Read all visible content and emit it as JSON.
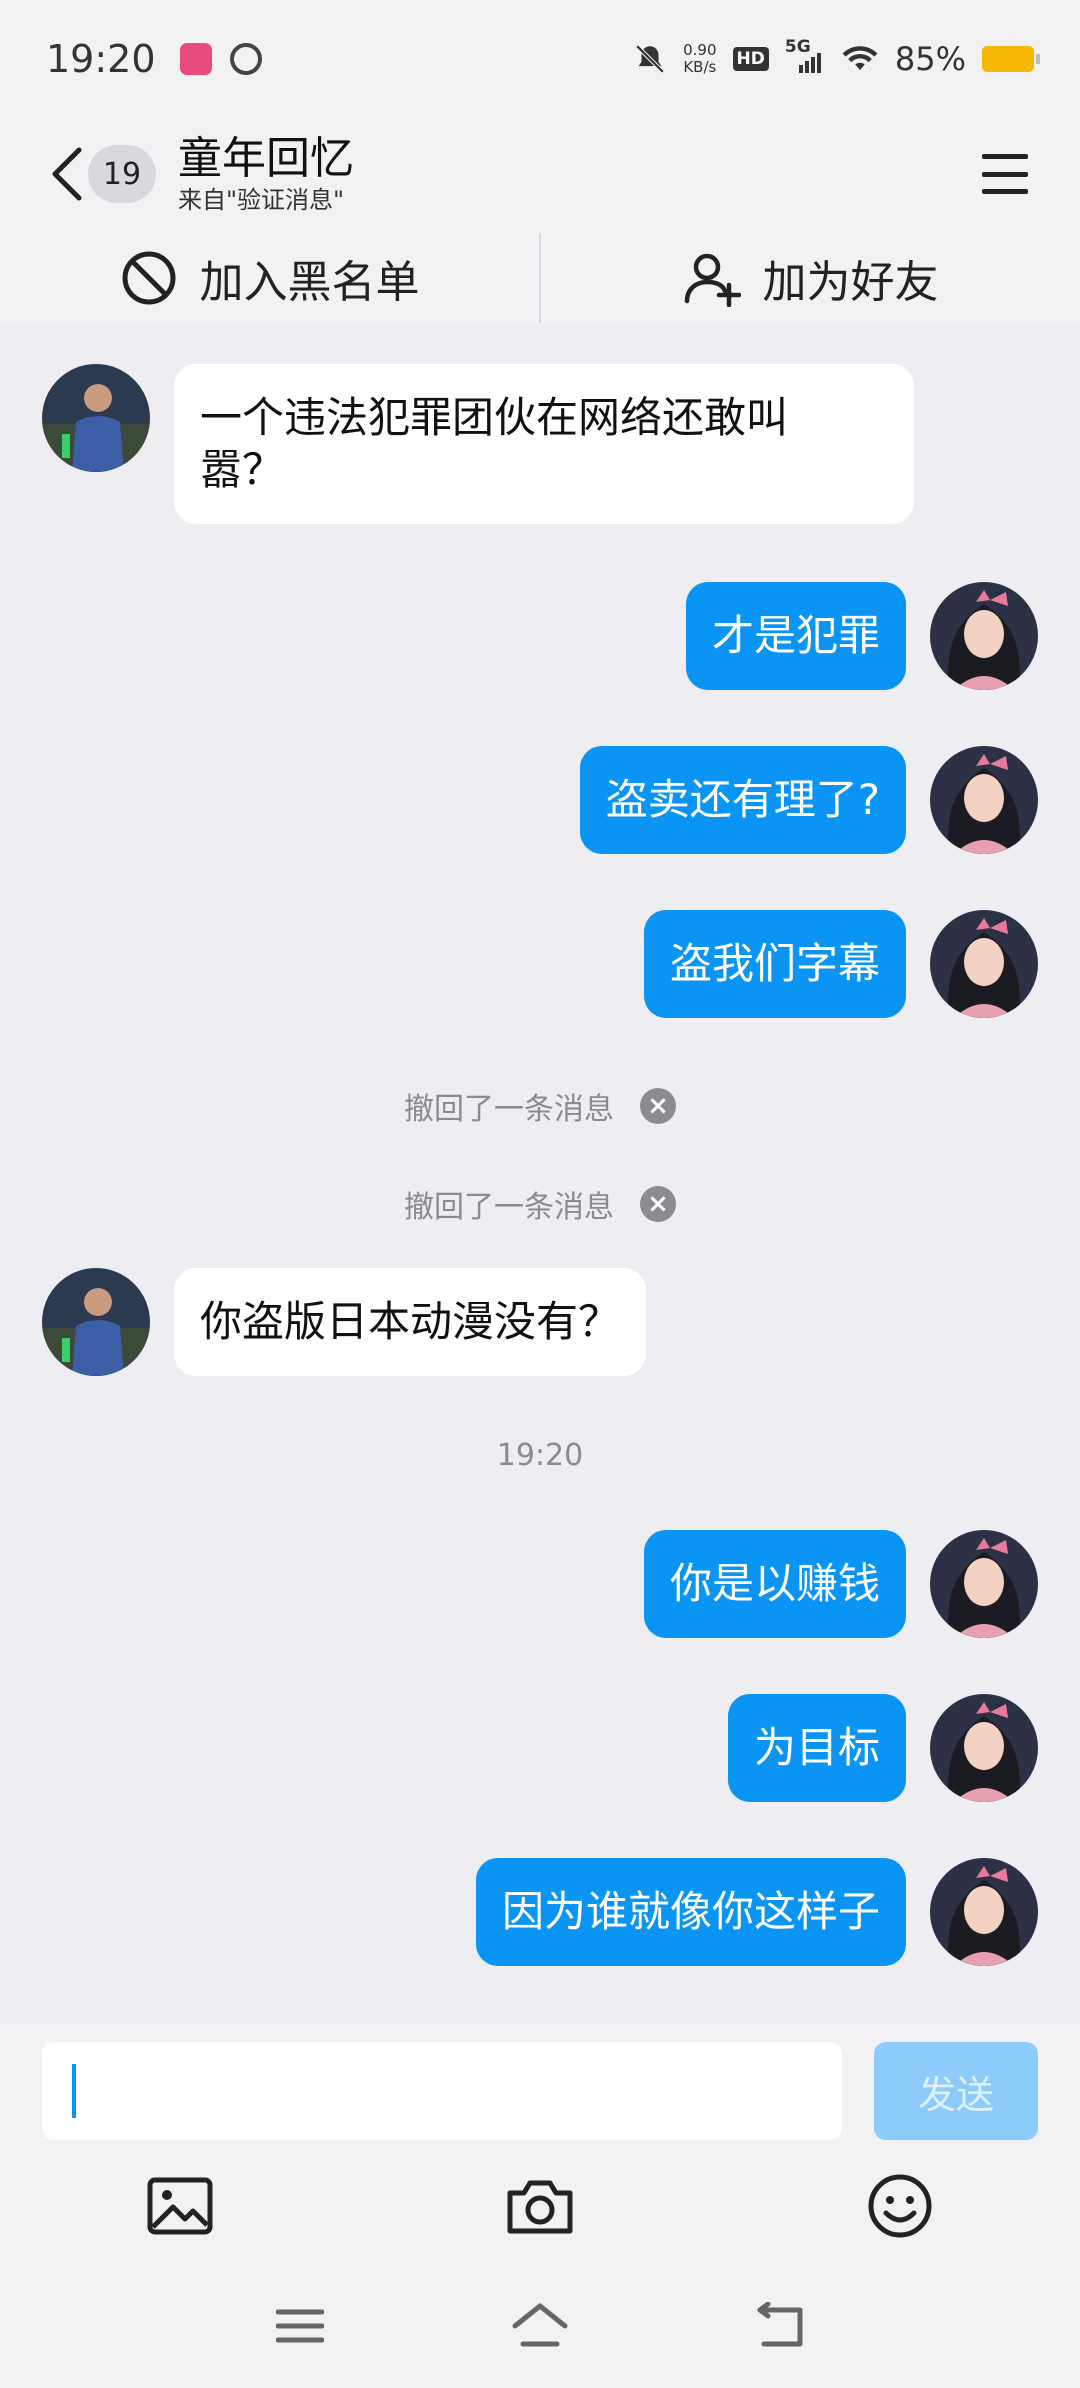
{
  "status_bar": {
    "time": "19:20",
    "net_speed_value": "0.90",
    "net_speed_unit": "KB/s",
    "hd": "HD",
    "network": "5G",
    "battery": "85%",
    "icons": [
      "mute-icon",
      "signal-icon",
      "wifi-icon",
      "battery-icon"
    ]
  },
  "header": {
    "back_count": "19",
    "title": "童年回忆",
    "subtitle": "来自\"验证消息\""
  },
  "actions": {
    "blacklist_label": "加入黑名单",
    "add_friend_label": "加为好友"
  },
  "messages": [
    {
      "side": "in",
      "text": "一个违法犯罪团伙在网络还敢叫\n嚣？"
    },
    {
      "side": "out",
      "text": "才是犯罪"
    },
    {
      "side": "out",
      "text": "盗卖还有理了?"
    },
    {
      "side": "out",
      "text": "盗我们字幕"
    },
    {
      "side": "out",
      "text": "你盗版日本动漫没有？"
    },
    {
      "side": "out",
      "text": "你是以赚钱"
    },
    {
      "side": "out",
      "text": "为目标"
    },
    {
      "side": "out",
      "text": "因为谁就像你这样子"
    }
  ],
  "recalled": [
    {
      "text": "撤回了一条消息"
    },
    {
      "text": "撤回了一条消息"
    }
  ],
  "timestamp": "19:20",
  "input": {
    "value": "",
    "send_label": "发送"
  },
  "colors": {
    "accent": "#0a95f5",
    "send_disabled": "#8ccbfa",
    "background": "#ededf2"
  }
}
